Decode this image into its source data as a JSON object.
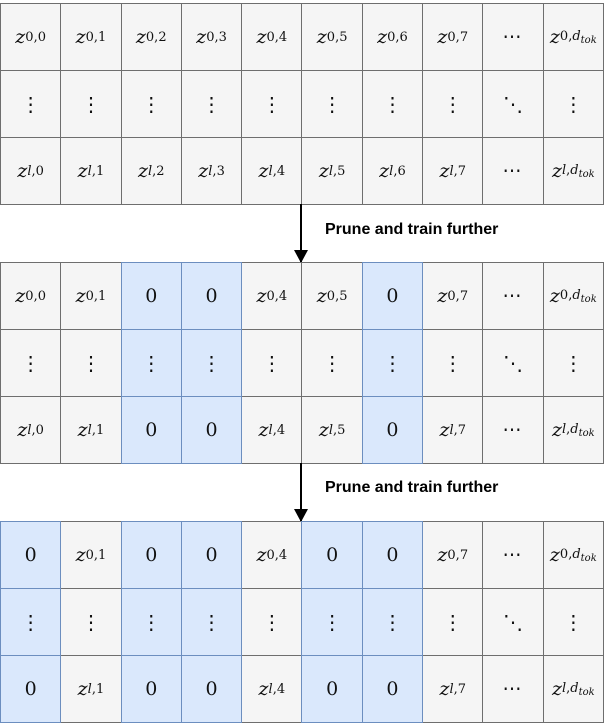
{
  "colors": {
    "cell_fill": "#f5f5f5",
    "cell_border": "#6e6e6e",
    "pruned_fill": "#dae8fc",
    "pruned_border": "#6c8ebf"
  },
  "steps": [
    {
      "label": "Prune and train further"
    },
    {
      "label": "Prune and train further"
    }
  ],
  "matrices": [
    {
      "name": "initial",
      "pruned_columns": []
    },
    {
      "name": "after-first-prune",
      "pruned_columns": [
        2,
        3,
        6
      ]
    },
    {
      "name": "after-second-prune",
      "pruned_columns": [
        0,
        2,
        3,
        5,
        6
      ]
    }
  ],
  "columns": [
    {
      "top": "z_{0,0}",
      "bottom": "z_{l,0}",
      "idx": "0"
    },
    {
      "top": "z_{0,1}",
      "bottom": "z_{l,1}",
      "idx": "1"
    },
    {
      "top": "z_{0,2}",
      "bottom": "z_{l,2}",
      "idx": "2"
    },
    {
      "top": "z_{0,3}",
      "bottom": "z_{l,3}",
      "idx": "3"
    },
    {
      "top": "z_{0,4}",
      "bottom": "z_{l,4}",
      "idx": "4"
    },
    {
      "top": "z_{0,5}",
      "bottom": "z_{l,5}",
      "idx": "5"
    },
    {
      "top": "z_{0,6}",
      "bottom": "z_{l,6}",
      "idx": "6"
    },
    {
      "top": "z_{0,7}",
      "bottom": "z_{l,7}",
      "idx": "7"
    },
    {
      "top": "cdots",
      "bottom": "cdots",
      "idx": "..."
    },
    {
      "top": "z_{0,d_tok}",
      "bottom": "z_{l,d_tok}",
      "idx": "d_tok"
    }
  ],
  "zero_value": "0",
  "symbols": {
    "z": "z",
    "row0": "0",
    "rowl": "l",
    "cdots": "⋯",
    "vdots": "⋮",
    "ddots": "⋱",
    "d": "d",
    "tok": "tok"
  }
}
